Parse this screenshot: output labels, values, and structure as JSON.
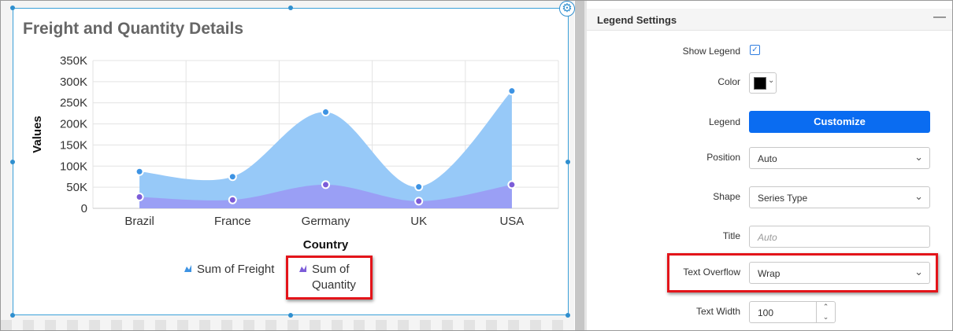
{
  "chart": {
    "title": "Freight and Quantity Details",
    "chart_data": {
      "type": "area",
      "categories": [
        "Brazil",
        "France",
        "Germany",
        "UK",
        "USA"
      ],
      "series": [
        {
          "name": "Sum of Freight",
          "values": [
            87000,
            75000,
            228000,
            51000,
            278000
          ],
          "color": "#97c9f8",
          "marker": "#3d93e3"
        },
        {
          "name": "Sum of Quantity",
          "values": [
            27000,
            20000,
            56000,
            17000,
            56000
          ],
          "color": "#9a9ff5",
          "marker": "#7c5cd8"
        }
      ],
      "xlabel": "Country",
      "ylabel": "Values",
      "ylim": [
        0,
        350000
      ],
      "yticks": [
        "0",
        "50K",
        "100K",
        "150K",
        "200K",
        "250K",
        "300K",
        "350K"
      ],
      "grid": true,
      "legend_position": "bottom"
    }
  },
  "panel": {
    "title": "Legend Settings",
    "collapse_icon": "minus-icon",
    "show_legend_label": "Show Legend",
    "show_legend_checked": true,
    "color_label": "Color",
    "color_value": "#000000",
    "legend_label": "Legend",
    "customize_label": "Customize",
    "position_label": "Position",
    "position_value": "Auto",
    "shape_label": "Shape",
    "shape_value": "Series Type",
    "title_label": "Title",
    "title_placeholder": "Auto",
    "text_overflow_label": "Text Overflow",
    "text_overflow_value": "Wrap",
    "text_width_label": "Text Width",
    "text_width_value": "100"
  }
}
